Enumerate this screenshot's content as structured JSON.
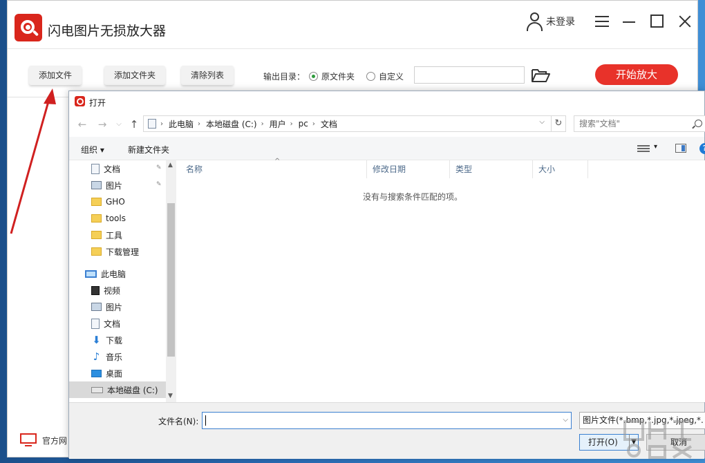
{
  "app": {
    "title": "闪电图片无损放大器",
    "user_label": "未登录",
    "toolbar": {
      "add_file": "添加文件",
      "add_folder": "添加文件夹",
      "clear_list": "清除列表",
      "output_label": "输出目录：",
      "radio_original": "原文件夹",
      "radio_custom": "自定义",
      "start_button": "开始放大"
    },
    "footer_link": "官方网"
  },
  "dialog": {
    "title": "打开",
    "breadcrumb": [
      "此电脑",
      "本地磁盘 (C:)",
      "用户",
      "pc",
      "文档"
    ],
    "search_placeholder": "搜索\"文档\"",
    "organize": "组织",
    "new_folder": "新建文件夹",
    "nav_items": [
      {
        "label": "文档",
        "icon": "document-icon",
        "pinned": true
      },
      {
        "label": "图片",
        "icon": "picture-icon",
        "pinned": true
      },
      {
        "label": "GHO",
        "icon": "folder-icon"
      },
      {
        "label": "tools",
        "icon": "folder-icon"
      },
      {
        "label": "工具",
        "icon": "folder-icon"
      },
      {
        "label": "下载管理",
        "icon": "folder-icon"
      },
      {
        "label": "此电脑",
        "icon": "computer-icon"
      },
      {
        "label": "视频",
        "icon": "video-icon"
      },
      {
        "label": "图片",
        "icon": "picture-icon"
      },
      {
        "label": "文档",
        "icon": "document-icon"
      },
      {
        "label": "下载",
        "icon": "download-icon"
      },
      {
        "label": "音乐",
        "icon": "music-icon"
      },
      {
        "label": "桌面",
        "icon": "desktop-icon"
      },
      {
        "label": "本地磁盘 (C:)",
        "icon": "drive-icon",
        "selected": true
      }
    ],
    "columns": [
      "名称",
      "修改日期",
      "类型",
      "大小"
    ],
    "empty_message": "没有与搜索条件匹配的项。",
    "filename_label": "文件名(N):",
    "filename_value": "",
    "filetype_value": "图片文件(*.bmp,*.jpg,*.jpeg,*.",
    "open_button": "打开(O)",
    "cancel_button": "取消"
  },
  "colors": {
    "brand_red": "#e8322a",
    "annotation_arrow": "#d02020",
    "accent_blue": "#3a7fd0"
  }
}
